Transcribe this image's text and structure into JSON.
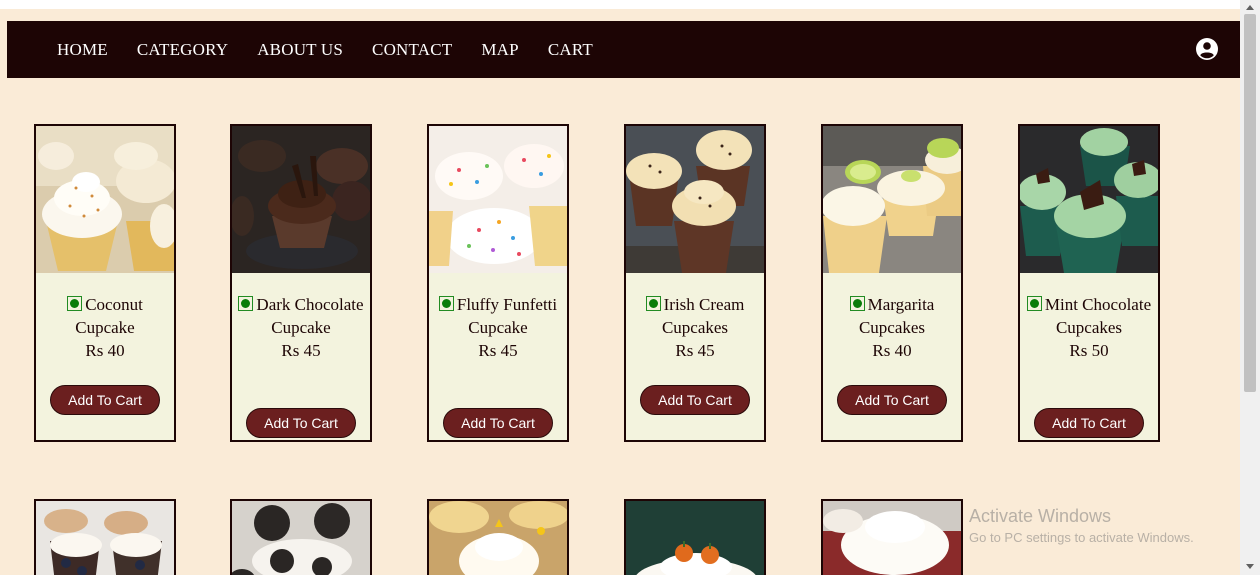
{
  "nav": {
    "items": [
      "HOME",
      "CATEGORY",
      "ABOUT US",
      "CONTACT",
      "MAP",
      "CART"
    ]
  },
  "products": [
    {
      "name": "Coconut Cupcake",
      "price": "Rs 40",
      "button": "Add To Cart"
    },
    {
      "name": "Dark Chocolate Cupcake",
      "price": "Rs 45",
      "button": "Add To Cart"
    },
    {
      "name": "Fluffy Funfetti Cupcake",
      "price": "Rs 45",
      "button": "Add To Cart"
    },
    {
      "name": "Irish Cream Cupcakes",
      "price": "Rs 45",
      "button": "Add To Cart"
    },
    {
      "name": "Margarita Cupcakes",
      "price": "Rs 40",
      "button": "Add To Cart"
    },
    {
      "name": "Mint Chocolate Cupcakes",
      "price": "Rs 50",
      "button": "Add To Cart"
    }
  ],
  "watermark": {
    "title": "Activate Windows",
    "subtitle": "Go to PC settings to activate Windows."
  },
  "colors": {
    "navbar": "#1d0505",
    "page_background": "#faebd7",
    "card_background": "#f3f3de",
    "button": "#6b1f1f",
    "veg_mark": "#0a7d0a"
  },
  "icons": [
    "account-icon",
    "veg-mark-icon"
  ]
}
